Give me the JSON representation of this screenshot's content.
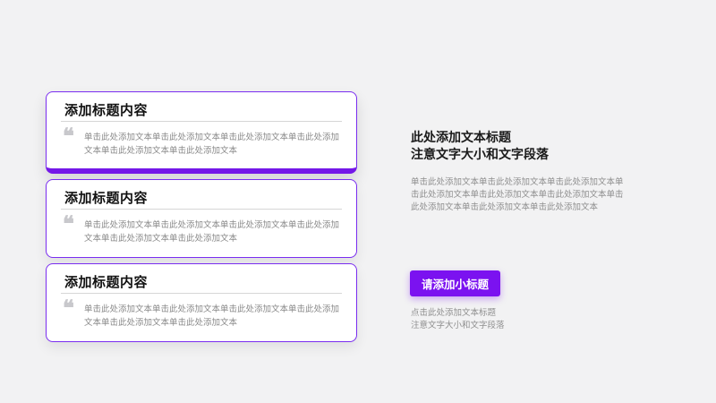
{
  "cards": [
    {
      "title": "添加标题内容",
      "quote_icon": "quote-icon",
      "body": "单击此处添加文本单击此处添加文本单击此处添加文本单击此处添加文本单击此处添加文本单击此处添加文本"
    },
    {
      "title": "添加标题内容",
      "quote_icon": "quote-icon",
      "body": "单击此处添加文本单击此处添加文本单击此处添加文本单击此处添加文本单击此处添加文本单击此处添加文本"
    },
    {
      "title": "添加标题内容",
      "quote_icon": "quote-icon",
      "body": "单击此处添加文本单击此处添加文本单击此处添加文本单击此处添加文本单击此处添加文本单击此处添加文本"
    }
  ],
  "right_panel": {
    "title_line1": "此处添加文本标题",
    "title_line2": "注意文字大小和文字段落",
    "body": "单击此处添加文本单击此处添加文本单击此处添加文本单击此处添加文本单击此处添加文本单击此处添加文本单击此处添加文本单击此处添加文本单击此处添加文本",
    "button_label": "请添加小标题",
    "note_line1": "点击此处添加文本标题",
    "note_line2": "注意文字大小和文字段落"
  },
  "colors": {
    "accent": "#7b12f0",
    "background": "#f2f2f3",
    "card_background": "#ffffff",
    "muted_text": "#8a8a8a"
  }
}
